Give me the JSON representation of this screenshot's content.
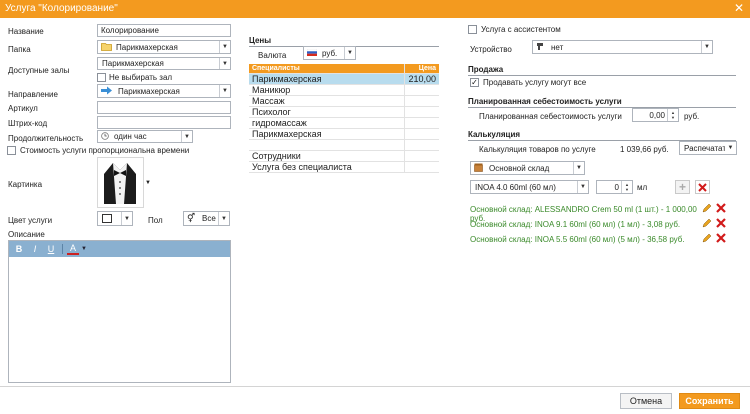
{
  "window": {
    "title": "Услуга \"Колорирование\"",
    "close_glyph": "✕"
  },
  "left": {
    "name_label": "Название",
    "name_value": "Колорирование",
    "folder_label": "Папка",
    "folder_value": "Парикмахерская",
    "halls_label": "Доступные залы",
    "halls_value": "Парикмахерская",
    "no_hall_label": "Не выбирать зал",
    "direction_label": "Направление",
    "direction_value": "Парикмахерская",
    "article_label": "Артикул",
    "article_value": "",
    "barcode_label": "Штрих-код",
    "barcode_value": "",
    "duration_label": "Продолжительность",
    "duration_value": "один час",
    "proportional_label": "Стоимость услуги пропорциональна времени",
    "picture_label": "Картинка",
    "color_label": "Цвет услуги",
    "gender_label": "Пол",
    "gender_value": "Все",
    "description_label": "Описание",
    "editor_bold": "B",
    "editor_italic": "I",
    "editor_underline": "U",
    "editor_color": "A",
    "description_value": ""
  },
  "prices": {
    "section_title": "Цены",
    "currency_label": "Валюта",
    "currency_value": "руб.",
    "col_specialists": "Специалисты",
    "col_price": "Цена",
    "rows": [
      {
        "name": "Парикмахерская",
        "price": "210,00"
      },
      {
        "name": "Маникюр",
        "price": ""
      },
      {
        "name": "Массаж",
        "price": ""
      },
      {
        "name": "Психолог",
        "price": ""
      },
      {
        "name": "гидромассаж",
        "price": ""
      },
      {
        "name": "Парикмахерская",
        "price": ""
      },
      {
        "name": "",
        "price": ""
      },
      {
        "name": "Сотрудники",
        "price": ""
      },
      {
        "name": "Услуга без специалиста",
        "price": ""
      }
    ]
  },
  "right": {
    "assistant_label": "Услуга с ассистентом",
    "device_label": "Устройство",
    "device_value": "нет",
    "sale_title": "Продажа",
    "sell_all_label": "Продавать услугу могут все",
    "sell_all_check": "✓",
    "cost_title": "Планированная себестоимость услуги",
    "cost_label": "Планированная себестоимость услуги",
    "cost_value": "0,00",
    "cost_unit": "руб.",
    "calc_title": "Калькуляция",
    "calc_label": "Калькуляция товаров по услуге",
    "calc_value": "1 039,66 руб.",
    "print_label": "Распечатать",
    "warehouse_value": "Основной склад",
    "product_value": "INOA 4.0 60ml (60 мл)",
    "qty_value": "0",
    "qty_unit": "мл",
    "items": [
      "Основной склад: ALESSANDRO Crem 50 ml (1 шт.) - 1 000,00 руб.",
      "Основной склад: INOA 9.1 60ml (60 мл) (1 мл) - 3,08 руб.",
      "Основной склад: INOA 5.5 60ml (60 мл) (5 мл) - 36,58 руб."
    ]
  },
  "footer": {
    "cancel_label": "Отмена",
    "save_label": "Сохранить"
  },
  "colors": {
    "accent": "#f39a1f",
    "selected_row": "#b8dcee",
    "item_text": "#3a8a2a",
    "delete": "#d11a1a"
  }
}
